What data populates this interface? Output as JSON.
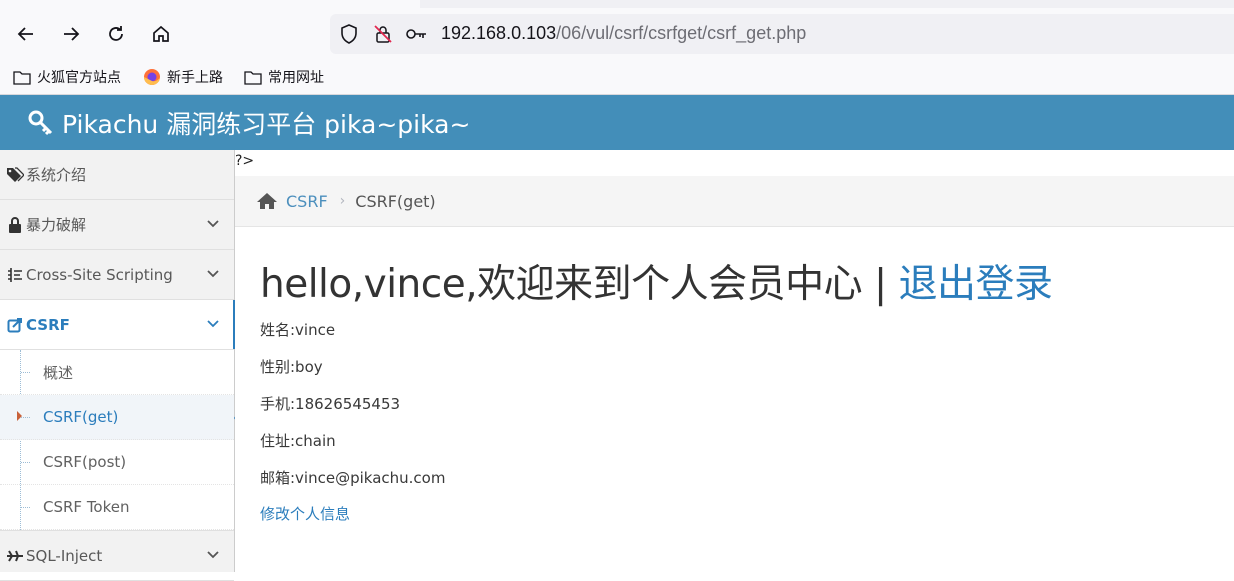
{
  "browser": {
    "url_host": "192.168.0.103",
    "url_path": "/06/vul/csrf/csrfget/csrf_get.php"
  },
  "bookmarks": [
    {
      "label": "火狐官方站点",
      "icon": "folder-icon"
    },
    {
      "label": "新手上路",
      "icon": "firefox-icon"
    },
    {
      "label": "常用网址",
      "icon": "folder-icon"
    }
  ],
  "header": {
    "title": "Pikachu 漏洞练习平台 pika~pika~"
  },
  "sidebar": {
    "items": [
      {
        "label": "系统介绍",
        "icon": "tags-icon"
      },
      {
        "label": "暴力破解",
        "icon": "lock-icon"
      },
      {
        "label": "Cross-Site Scripting",
        "icon": "list-icon"
      },
      {
        "label": "CSRF",
        "icon": "external-edit-icon"
      },
      {
        "label": "SQL-Inject",
        "icon": "plane-icon"
      }
    ],
    "csrf_sub": [
      "概述",
      "CSRF(get)",
      "CSRF(post)",
      "CSRF Token"
    ]
  },
  "main": {
    "stray_text": "?>",
    "breadcrumb": {
      "link": "CSRF",
      "current": "CSRF(get)"
    },
    "headline": "hello,vince,欢迎来到个人会员中心 | ",
    "logout": "退出登录",
    "info": [
      "姓名:vince",
      "性别:boy",
      "手机:18626545453",
      "住址:chain",
      "邮箱:vince@pikachu.com"
    ],
    "edit_link": "修改个人信息"
  },
  "colors": {
    "header": "#438eb9",
    "accent": "#2b7dbc"
  }
}
